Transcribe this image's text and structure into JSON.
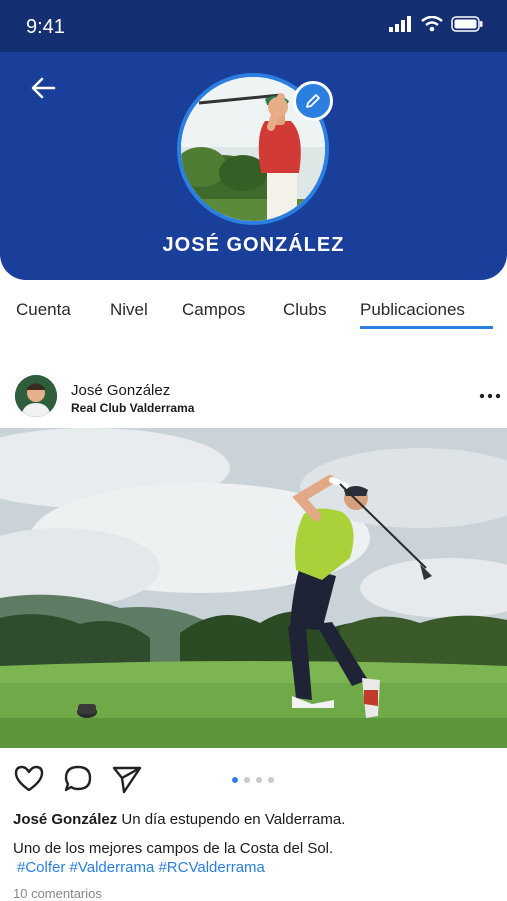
{
  "status_bar": {
    "time": "9:41"
  },
  "profile": {
    "name": "JOSÉ GONZÁLEZ"
  },
  "tabs": [
    {
      "label": "Cuenta"
    },
    {
      "label": "Nivel"
    },
    {
      "label": "Campos"
    },
    {
      "label": "Clubs"
    },
    {
      "label": "Publicaciones",
      "active": true
    }
  ],
  "post": {
    "author": "José González",
    "club": "Real Club Valderrama",
    "caption_author": "José González",
    "caption_text": " Un día estupendo en Valderrama.",
    "caption_line2": "Uno de los mejores campos de la Costa del Sol.",
    "hashtags": "#Colfer #Valderrama #RCValderrama",
    "comments": "10 comentarios",
    "carousel_count": 4,
    "carousel_active": 0
  },
  "colors": {
    "header": "#1a3f9a",
    "status_bar": "#152f73",
    "accent": "#2a7fe0"
  },
  "icons": {
    "back": "arrow-left-icon",
    "edit": "pencil-icon",
    "more": "ellipsis-icon",
    "like": "heart-icon",
    "comment": "speech-bubble-icon",
    "share": "paper-plane-icon"
  }
}
